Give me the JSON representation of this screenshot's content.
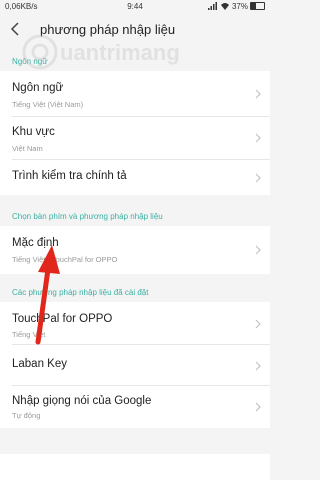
{
  "status_bar": {
    "left": "0,06KB/s",
    "time": "9:44",
    "battery": "37%",
    "battery_level": 0.37
  },
  "header": {
    "title": "phương pháp nhập liệu",
    "back_icon": "back-arrow-icon"
  },
  "watermark_text": "uantrimang",
  "sections": {
    "language": {
      "header": "Ngôn ngữ",
      "items": [
        {
          "label": "Ngôn ngữ",
          "sub": "Tiếng Việt (Việt Nam)"
        },
        {
          "label": "Khu vực",
          "sub": "Việt Nam"
        },
        {
          "label": "Trình kiểm tra chính tả",
          "sub": ""
        }
      ]
    },
    "keyboard": {
      "header": "Chọn bàn phím và phương pháp nhập liệu",
      "items": [
        {
          "label": "Mặc định",
          "sub": "Tiếng Việt - TouchPal for OPPO"
        }
      ]
    },
    "installed": {
      "header": "Các phương pháp nhập liệu đã cài đặt",
      "items": [
        {
          "label": "TouchPal for OPPO",
          "sub": "Tiếng Việt"
        },
        {
          "label": "Laban Key",
          "sub": ""
        },
        {
          "label": "Nhập giọng nói của Google",
          "sub": "Tự động"
        }
      ]
    }
  },
  "colors": {
    "section_header": "#3bb0a4",
    "annotation_arrow": "#e1261c"
  }
}
